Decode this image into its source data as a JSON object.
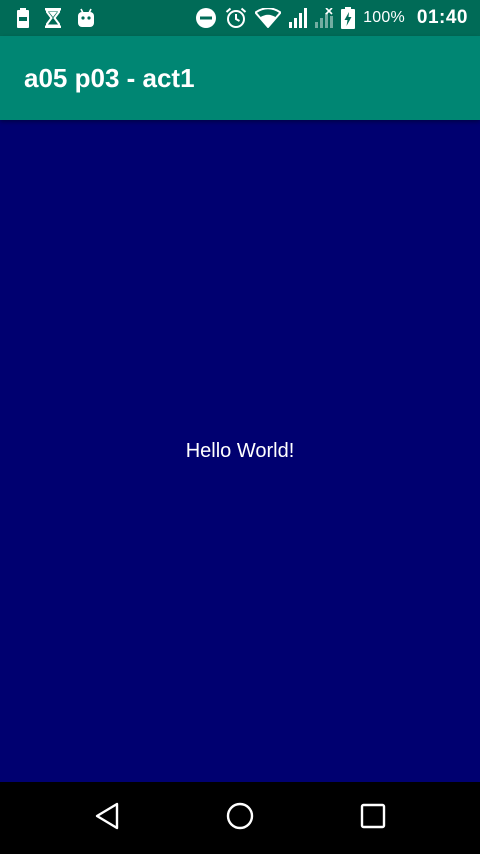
{
  "status_bar": {
    "left_icons": [
      "battery-saver-notification-icon",
      "hourglass-icon",
      "android-icon"
    ],
    "right_icons": [
      "do-not-disturb-icon",
      "alarm-icon",
      "wifi-icon",
      "cell-signal-icon",
      "cell-signal-off-icon",
      "battery-charging-icon"
    ],
    "battery_percent": "100%",
    "time": "01:40"
  },
  "app_bar": {
    "title": "a05 p03 - act1"
  },
  "content": {
    "text": "Hello World!"
  },
  "nav_bar": {
    "buttons": [
      "back",
      "home",
      "recents"
    ]
  },
  "colors": {
    "status_bar": "#006b57",
    "app_bar": "#008673",
    "background": "#000070",
    "nav_bar": "#000000",
    "text": "#ffffff"
  }
}
